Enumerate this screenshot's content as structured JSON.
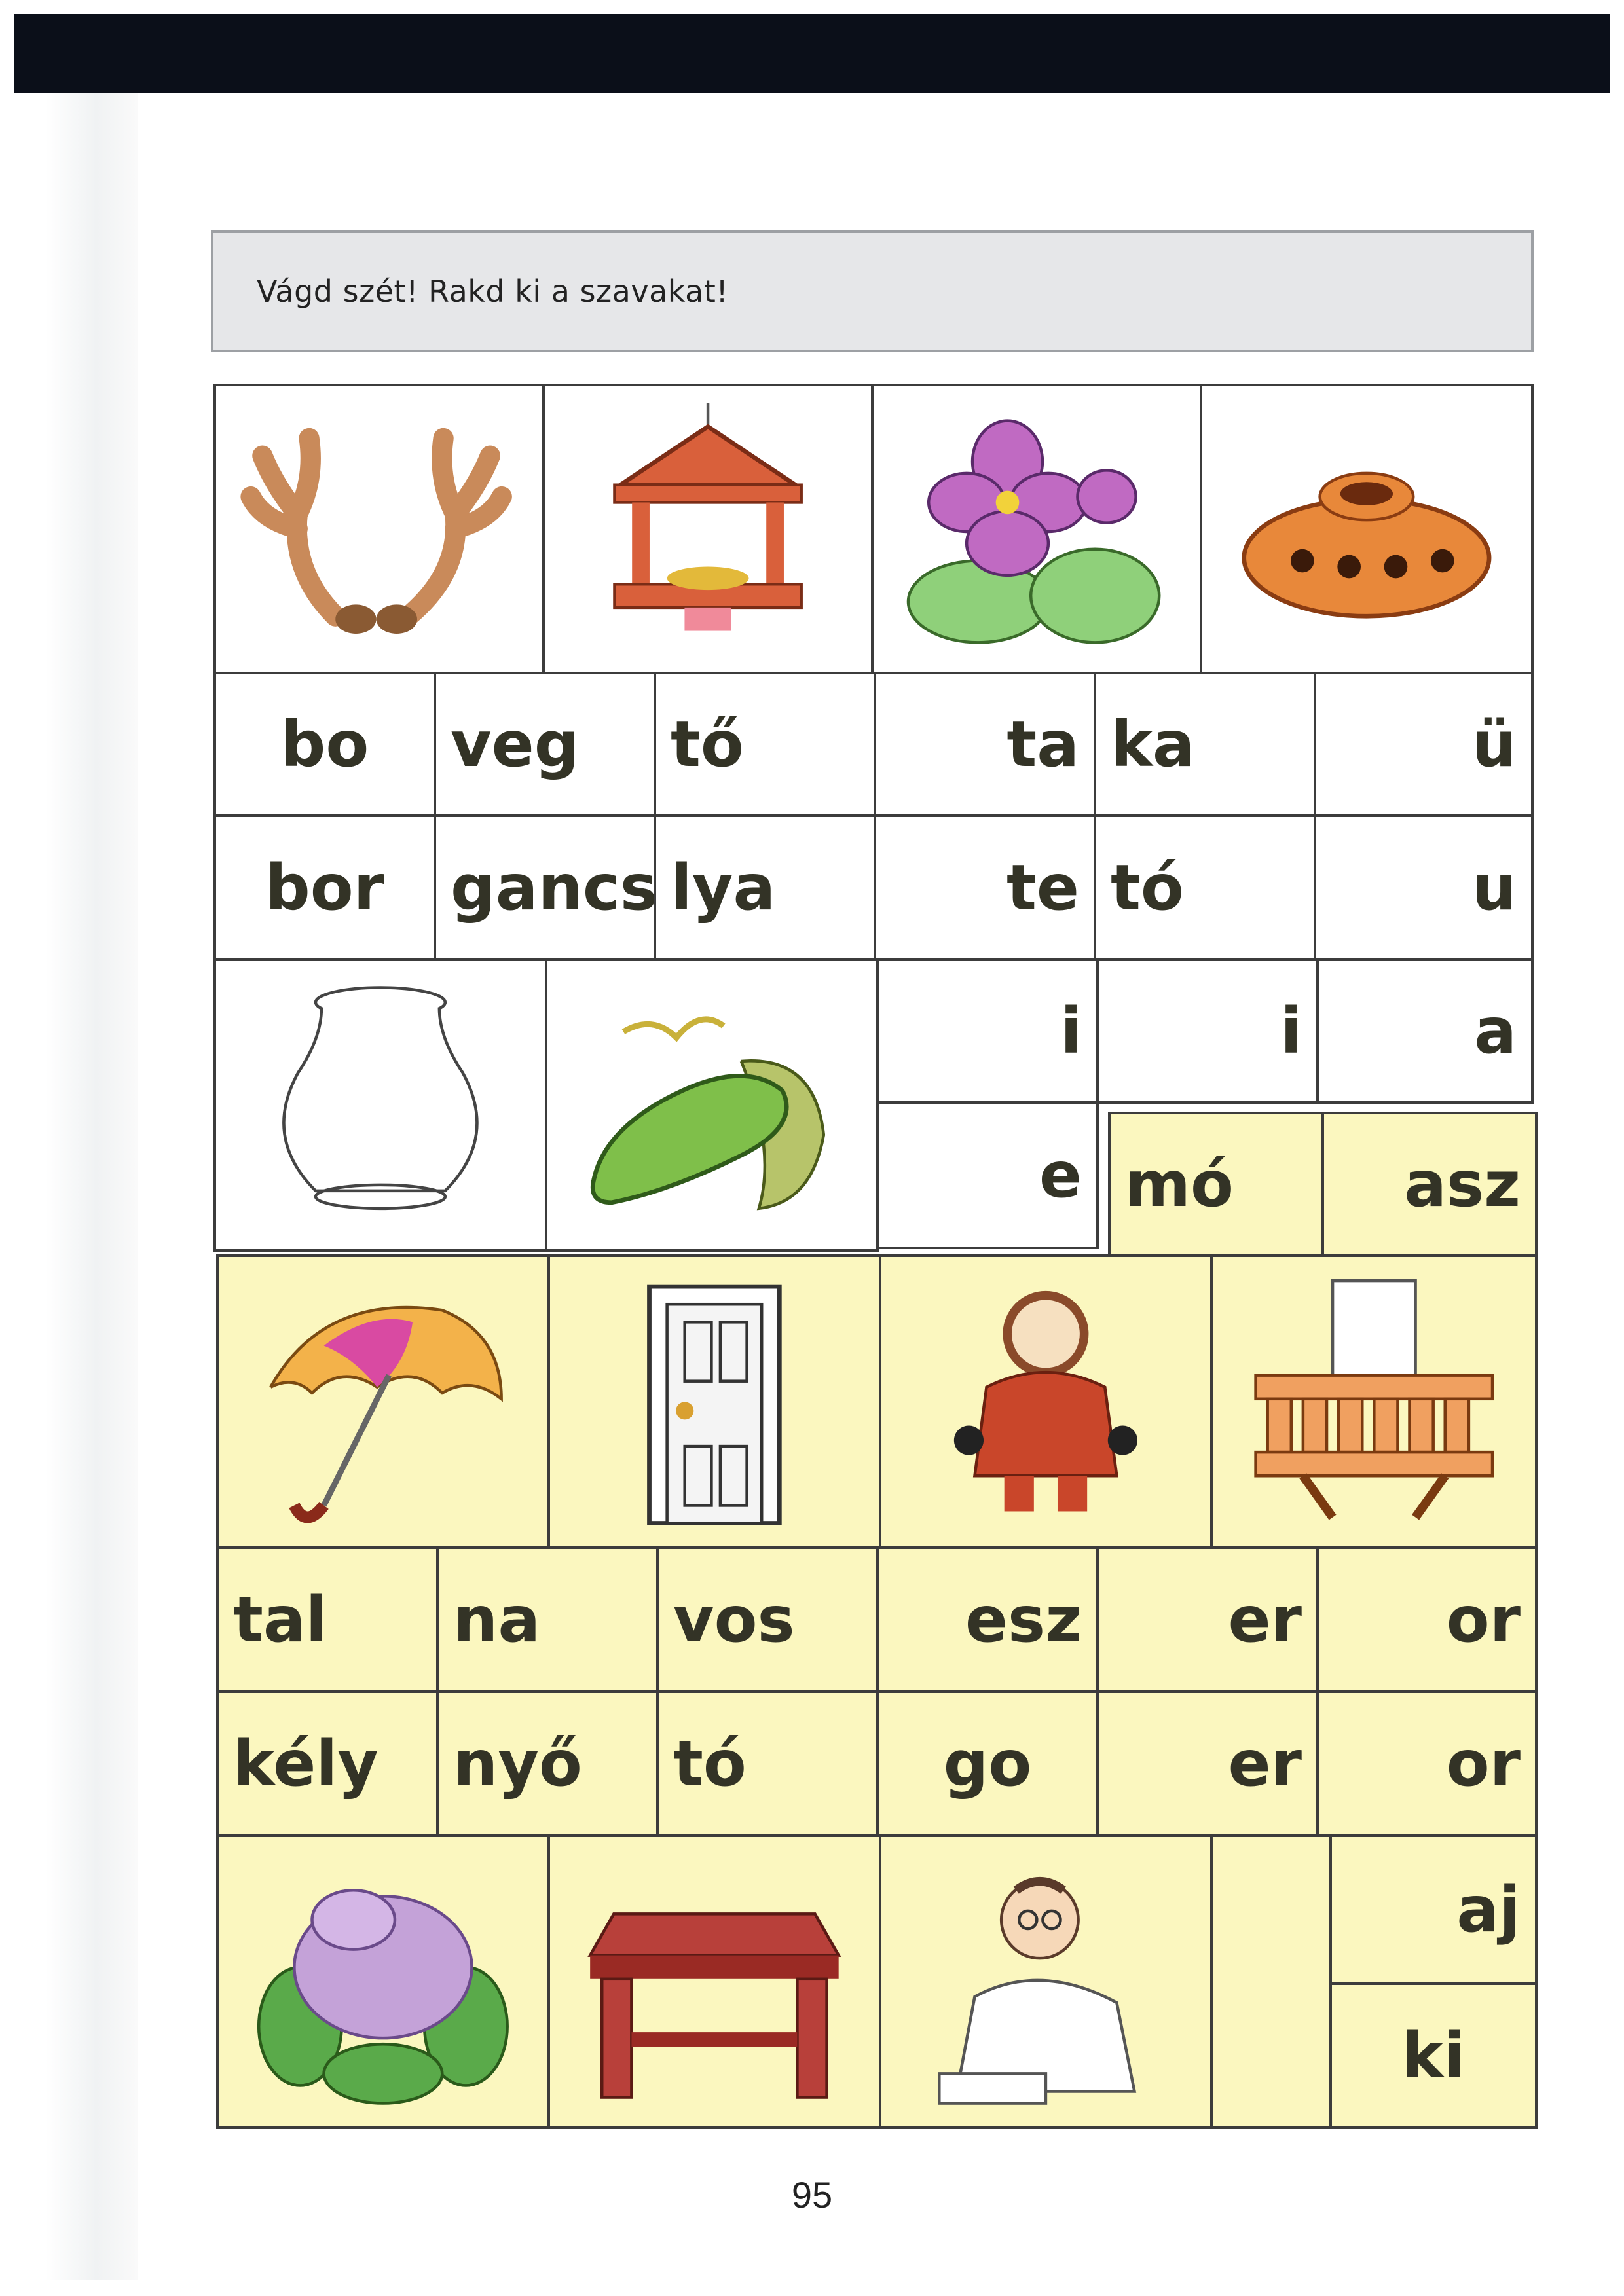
{
  "instruction": "Vágd szét! Rakd ki a szavakat!",
  "page_number": "95",
  "white_sheet": {
    "pictures": [
      "antlers",
      "bird-feeder",
      "violet",
      "ocarina",
      "vase",
      "cucumber"
    ],
    "syllables": {
      "r1c1": "bo",
      "r1c2": "veg",
      "r1c3": "tő",
      "r1c4": "ta",
      "r1c5": "ka",
      "r1c6": "ü",
      "r2c1": "bor",
      "r2c2": "gancs",
      "r2c3": "lya",
      "r2c4": "te",
      "r2c5": "tó",
      "r2c6": "u",
      "r3c4": "i",
      "r3c5": "i",
      "r3c6": "a",
      "r4c4": "e"
    }
  },
  "yellow_sheet": {
    "pictures": [
      "umbrella",
      "door",
      "child-in-winter-coat",
      "balcony",
      "lilac",
      "stool",
      "writing-man"
    ],
    "syllables": {
      "top1": "mó",
      "top2": "asz",
      "r1c1": "tal",
      "r1c2": "na",
      "r1c3": "vos",
      "r1c4": "esz",
      "r1c5": "er",
      "r1c6": "or",
      "r2c1": "kély",
      "r2c2": "nyő",
      "r2c3": "tó",
      "r2c4": "go",
      "r2c5": "er",
      "r2c6": "or",
      "r3a": "aj",
      "r3b": "ki"
    }
  }
}
